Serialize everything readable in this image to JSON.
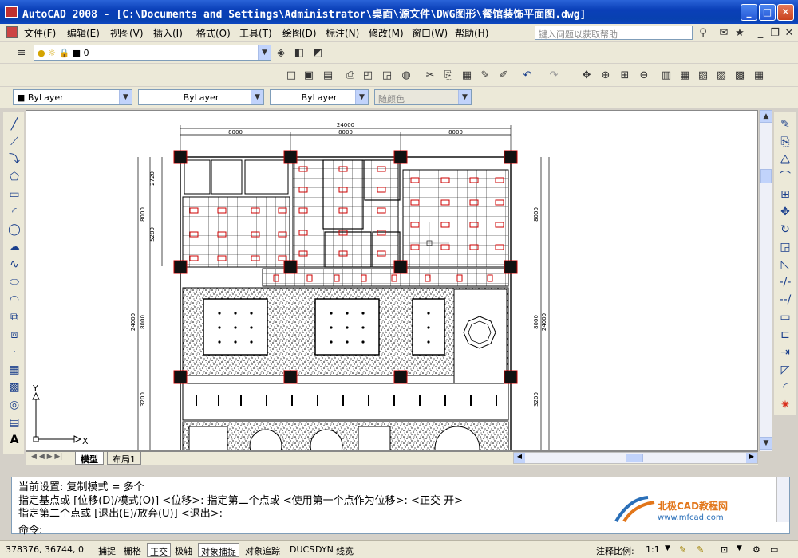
{
  "window": {
    "title": "AutoCAD 2008 - [C:\\Documents and Settings\\Administrator\\桌面\\源文件\\DWG图形\\餐馆装饰平面图.dwg]",
    "minimize": "_",
    "maximize": "□",
    "close": "✕"
  },
  "menu": {
    "items": [
      "文件(F)",
      "编辑(E)",
      "视图(V)",
      "插入(I)",
      "格式(O)",
      "工具(T)",
      "绘图(D)",
      "标注(N)",
      "修改(M)",
      "窗口(W)",
      "帮助(H)"
    ],
    "help_placeholder": "键入问题以获取帮助"
  },
  "layer": {
    "current": "0"
  },
  "properties": {
    "color": "ByLayer",
    "linetype": "ByLayer",
    "lineweight": "ByLayer",
    "plotstyle": "随颜色"
  },
  "drawing": {
    "overall_width": "24000",
    "top_spans": [
      "8000",
      "8000",
      "8000"
    ],
    "left_dims": [
      "2720",
      "5280",
      "8000",
      "8000",
      "3200"
    ],
    "total_height": "24000",
    "right_dims": [
      "8000",
      "8000",
      "3200"
    ],
    "right_total": "24000",
    "ucs_x": "X",
    "ucs_y": "Y"
  },
  "tabs": {
    "model": "模型",
    "layout1": "布局1"
  },
  "command": {
    "line1": "当前设置:  复制模式 = 多个",
    "line2": "指定基点或 [位移(D)/模式(O)] <位移>: 指定第二个点或 <使用第一个点作为位移>:  <正交 开>",
    "line3": "指定第二个点或 [退出(E)/放弃(U)] <退出>:",
    "prompt": "命令:"
  },
  "watermark": {
    "brand": "北极CAD教程网",
    "url": "www.mfcad.com"
  },
  "status": {
    "coords": "378376, 36744, 0",
    "buttons": [
      "捕捉",
      "栅格",
      "正交",
      "极轴",
      "对象捕捉",
      "对象追踪",
      "DUCS",
      "DYN",
      "线宽"
    ],
    "active": [
      "正交",
      "对象捕捉"
    ],
    "annotation_scale_label": "注释比例:",
    "annotation_scale": "1:1"
  },
  "colors": {
    "titlebar": "#0a3fb8",
    "dim_red": "#cc0000",
    "accent": "#d92e1c"
  }
}
